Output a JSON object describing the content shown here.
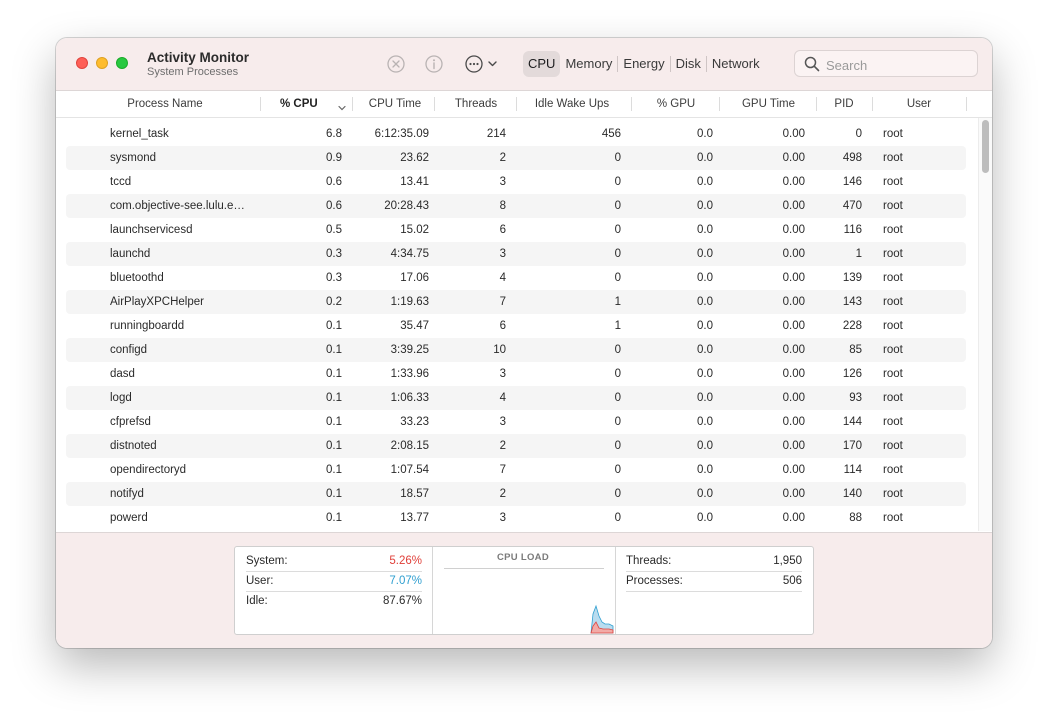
{
  "app": {
    "title": "Activity Monitor",
    "subtitle": "System Processes"
  },
  "toolbar": {
    "icons": [
      "stop-process-icon",
      "info-icon",
      "more-actions-icon"
    ],
    "tabs": [
      {
        "label": "CPU",
        "active": true
      },
      {
        "label": "Memory",
        "active": false
      },
      {
        "label": "Energy",
        "active": false
      },
      {
        "label": "Disk",
        "active": false
      },
      {
        "label": "Network",
        "active": false
      }
    ],
    "search_placeholder": "Search"
  },
  "table": {
    "columns": {
      "name": "Process Name",
      "cpu": "% CPU",
      "cpu_time": "CPU Time",
      "threads": "Threads",
      "idle_wake_ups": "Idle Wake Ups",
      "gpu": "% GPU",
      "gpu_time": "GPU Time",
      "pid": "PID",
      "user": "User"
    },
    "sorted_column": "% CPU",
    "rows": [
      {
        "name": "kernel_task",
        "cpu": "6.8",
        "cpu_time": "6:12:35.09",
        "threads": "214",
        "idle": "456",
        "gpu": "0.0",
        "gpu_time": "0.00",
        "pid": "0",
        "user": "root"
      },
      {
        "name": "sysmond",
        "cpu": "0.9",
        "cpu_time": "23.62",
        "threads": "2",
        "idle": "0",
        "gpu": "0.0",
        "gpu_time": "0.00",
        "pid": "498",
        "user": "root"
      },
      {
        "name": "tccd",
        "cpu": "0.6",
        "cpu_time": "13.41",
        "threads": "3",
        "idle": "0",
        "gpu": "0.0",
        "gpu_time": "0.00",
        "pid": "146",
        "user": "root"
      },
      {
        "name": "com.objective-see.lulu.e…",
        "cpu": "0.6",
        "cpu_time": "20:28.43",
        "threads": "8",
        "idle": "0",
        "gpu": "0.0",
        "gpu_time": "0.00",
        "pid": "470",
        "user": "root"
      },
      {
        "name": "launchservicesd",
        "cpu": "0.5",
        "cpu_time": "15.02",
        "threads": "6",
        "idle": "0",
        "gpu": "0.0",
        "gpu_time": "0.00",
        "pid": "116",
        "user": "root"
      },
      {
        "name": "launchd",
        "cpu": "0.3",
        "cpu_time": "4:34.75",
        "threads": "3",
        "idle": "0",
        "gpu": "0.0",
        "gpu_time": "0.00",
        "pid": "1",
        "user": "root"
      },
      {
        "name": "bluetoothd",
        "cpu": "0.3",
        "cpu_time": "17.06",
        "threads": "4",
        "idle": "0",
        "gpu": "0.0",
        "gpu_time": "0.00",
        "pid": "139",
        "user": "root"
      },
      {
        "name": "AirPlayXPCHelper",
        "cpu": "0.2",
        "cpu_time": "1:19.63",
        "threads": "7",
        "idle": "1",
        "gpu": "0.0",
        "gpu_time": "0.00",
        "pid": "143",
        "user": "root"
      },
      {
        "name": "runningboardd",
        "cpu": "0.1",
        "cpu_time": "35.47",
        "threads": "6",
        "idle": "1",
        "gpu": "0.0",
        "gpu_time": "0.00",
        "pid": "228",
        "user": "root"
      },
      {
        "name": "configd",
        "cpu": "0.1",
        "cpu_time": "3:39.25",
        "threads": "10",
        "idle": "0",
        "gpu": "0.0",
        "gpu_time": "0.00",
        "pid": "85",
        "user": "root"
      },
      {
        "name": "dasd",
        "cpu": "0.1",
        "cpu_time": "1:33.96",
        "threads": "3",
        "idle": "0",
        "gpu": "0.0",
        "gpu_time": "0.00",
        "pid": "126",
        "user": "root"
      },
      {
        "name": "logd",
        "cpu": "0.1",
        "cpu_time": "1:06.33",
        "threads": "4",
        "idle": "0",
        "gpu": "0.0",
        "gpu_time": "0.00",
        "pid": "93",
        "user": "root"
      },
      {
        "name": "cfprefsd",
        "cpu": "0.1",
        "cpu_time": "33.23",
        "threads": "3",
        "idle": "0",
        "gpu": "0.0",
        "gpu_time": "0.00",
        "pid": "144",
        "user": "root"
      },
      {
        "name": "distnoted",
        "cpu": "0.1",
        "cpu_time": "2:08.15",
        "threads": "2",
        "idle": "0",
        "gpu": "0.0",
        "gpu_time": "0.00",
        "pid": "170",
        "user": "root"
      },
      {
        "name": "opendirectoryd",
        "cpu": "0.1",
        "cpu_time": "1:07.54",
        "threads": "7",
        "idle": "0",
        "gpu": "0.0",
        "gpu_time": "0.00",
        "pid": "114",
        "user": "root"
      },
      {
        "name": "notifyd",
        "cpu": "0.1",
        "cpu_time": "18.57",
        "threads": "2",
        "idle": "0",
        "gpu": "0.0",
        "gpu_time": "0.00",
        "pid": "140",
        "user": "root"
      },
      {
        "name": "powerd",
        "cpu": "0.1",
        "cpu_time": "13.77",
        "threads": "3",
        "idle": "0",
        "gpu": "0.0",
        "gpu_time": "0.00",
        "pid": "88",
        "user": "root"
      }
    ]
  },
  "summary": {
    "system_label": "System:",
    "system_value": "5.26%",
    "user_label": "User:",
    "user_value": "7.07%",
    "idle_label": "Idle:",
    "idle_value": "87.67%",
    "cpu_load_title": "CPU LOAD",
    "threads_label": "Threads:",
    "threads_value": "1,950",
    "processes_label": "Processes:",
    "processes_value": "506"
  },
  "colors": {
    "system": "#e0403a",
    "user": "#2f9fd0",
    "titlebar": "#f7ecec"
  }
}
